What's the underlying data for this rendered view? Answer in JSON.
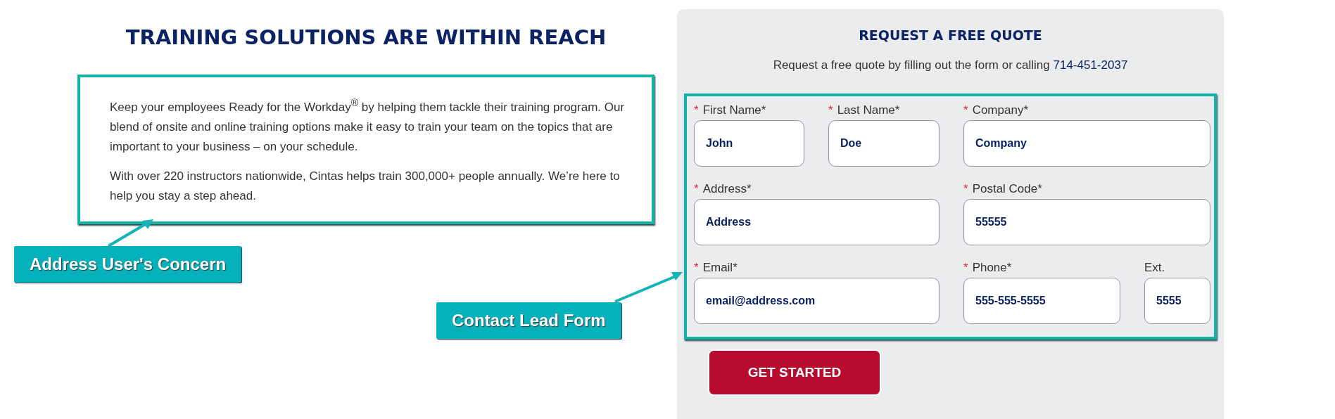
{
  "intro": {
    "heading": "TRAINING SOLUTIONS ARE WITHIN REACH",
    "paragraphs": [
      "Keep your employees Ready for the Workday$^{®}$ by helping them tackle their training program. Our blend of onsite and online training options make it easy to train your team on the topics that are important to your business – on your schedule.",
      "With over 220 instructors nationwide, Cintas helps train 300,000+ people annually. We’re here to help you stay a step ahead."
    ]
  },
  "quote_form": {
    "title": "REQUEST A FREE QUOTE",
    "subtitle": "Request a free quote by filling out the form or calling",
    "phone": "714-451-2037",
    "fields": [
      {
        "label": "First Name*",
        "required_mark": "*",
        "value": "John"
      },
      {
        "label": "Last Name*",
        "required_mark": "*",
        "value": "Doe"
      },
      {
        "label": "Company*",
        "required_mark": "*",
        "value": "Company"
      },
      {
        "label": "Address*",
        "required_mark": "*",
        "value": "Address"
      },
      {
        "label": "Postal Code*",
        "required_mark": "*",
        "value": "55555"
      },
      {
        "label": "Email*",
        "required_mark": "*",
        "value": "email@address.com"
      },
      {
        "label": "Phone*",
        "required_mark": "*",
        "value": "555-555-5555"
      },
      {
        "label": "Ext.",
        "value": "5555"
      }
    ],
    "submit": "GET STARTED"
  },
  "annotations": [
    {
      "text": "Address User's Concern"
    },
    {
      "text": "Contact Lead Form"
    }
  ]
}
